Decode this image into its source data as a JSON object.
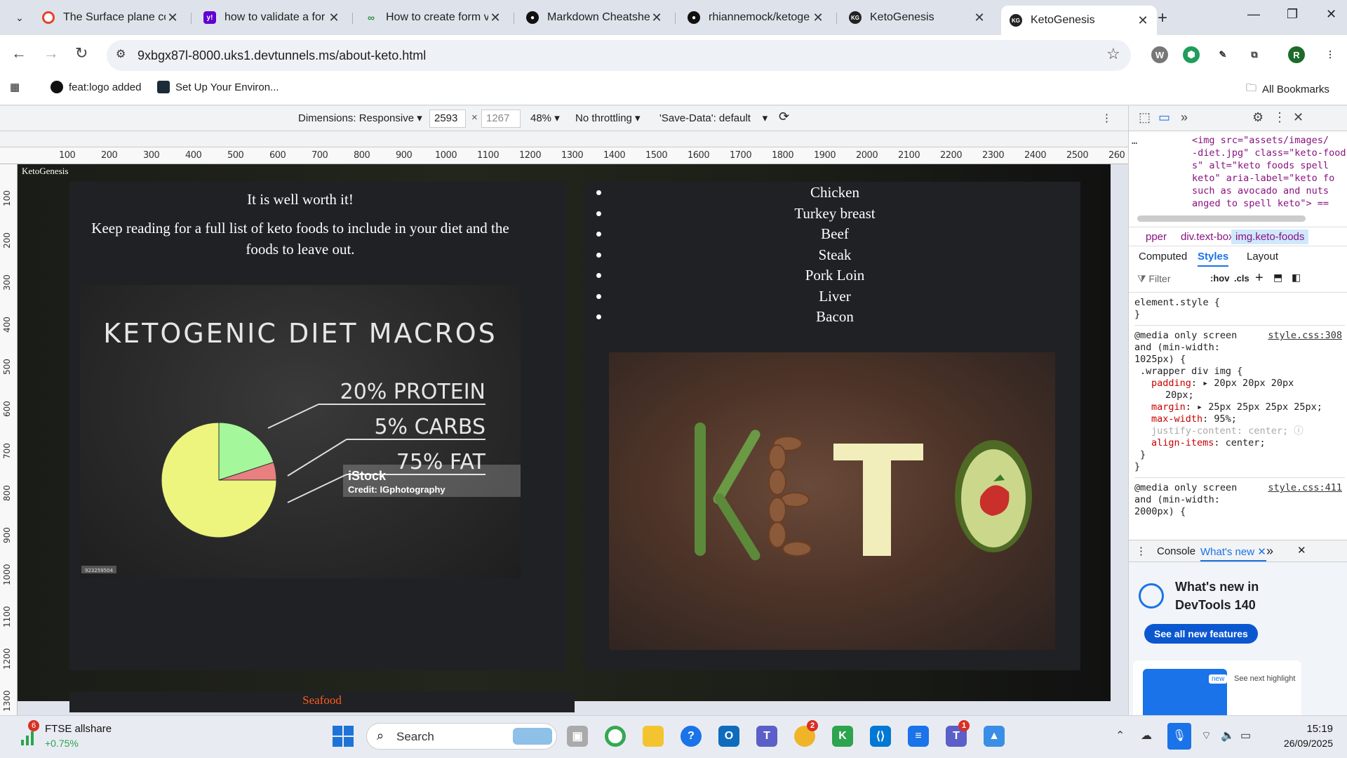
{
  "browser": {
    "tabs": [
      {
        "title": "The Surface plane co",
        "icon": "opera-icon",
        "color": "#e8412a"
      },
      {
        "title": "how to validate a for",
        "icon": "yahoo-icon",
        "color": "#6001d2"
      },
      {
        "title": "How to create form v",
        "icon": "geeks-icon",
        "color": "#2f8d46"
      },
      {
        "title": "Markdown Cheatshe",
        "icon": "github-icon",
        "color": "#111111"
      },
      {
        "title": "rhiannemock/ketoge",
        "icon": "github-icon",
        "color": "#111111"
      },
      {
        "title": "KetoGenesis",
        "icon": "kg-icon",
        "color": "#222222"
      },
      {
        "title": "KetoGenesis",
        "icon": "kg-icon",
        "color": "#222222"
      }
    ],
    "url": "9xbgx87l-8000.uks1.devtunnels.ms/about-keto.html",
    "bookmarks": [
      {
        "label": "feat:logo added",
        "icon": "github-icon"
      },
      {
        "label": "Set Up Your Environ...",
        "icon": "react-icon"
      }
    ],
    "all_bookmarks": "All Bookmarks",
    "profile_initial": "R"
  },
  "device_toolbar": {
    "dimensions": "Dimensions: Responsive",
    "width": "2593",
    "height": "1267",
    "zoom": "48%",
    "throttling": "No throttling",
    "save_data": "'Save-Data': default"
  },
  "ruler": {
    "h_labels": [
      "100",
      "200",
      "300",
      "400",
      "500",
      "600",
      "700",
      "800",
      "900",
      "1000",
      "1100",
      "1200",
      "1300",
      "1400",
      "1500",
      "1600",
      "1700",
      "1800",
      "1900",
      "2000",
      "2100",
      "2200",
      "2300",
      "2400",
      "2500",
      "260"
    ],
    "v_labels": [
      "100",
      "200",
      "300",
      "400",
      "500",
      "600",
      "700",
      "800",
      "900",
      "1000",
      "1100",
      "1200",
      "1300"
    ]
  },
  "page": {
    "site_title": "KetoGenesis",
    "worth": "It is well worth it!",
    "keep_reading": "Keep reading for a full list of keto foods to include in your diet and the foods to leave out.",
    "macros_image": {
      "title": "KETOGENIC DIET MACROS",
      "protein": "20% PROTEIN",
      "carbs": "5% CARBS",
      "fat": "75% FAT",
      "watermark": "iStock",
      "credit": "Credit: IGphotography",
      "stock_id": "923259504",
      "colors": {
        "protein": "#a4f79a",
        "carbs": "#e88080",
        "fat": "#eef57e"
      }
    },
    "meats": [
      "Chicken",
      "Turkey breast",
      "Beef",
      "Steak",
      "Pork Loin",
      "Liver",
      "Bacon"
    ],
    "seafood": "Seafood"
  },
  "devtools": {
    "html_snippet": [
      "<img src=\"assets/images/",
      "-diet.jpg\" class=\"keto-food",
      "s\" alt=\"keto foods spell",
      "keto\" aria-label=\"keto fo",
      "such as avocado and nuts",
      "anged to spell keto\"> =="
    ],
    "breadcrumbs": [
      "pper",
      "div.text-box",
      "img.keto-foods"
    ],
    "tabs": [
      "Computed",
      "Styles",
      "Layout"
    ],
    "filter_placeholder": "Filter",
    "hov": ":hov",
    "cls": ".cls",
    "element_style": "element.style {",
    "close_brace": "}",
    "rule1": {
      "media": "@media only screen",
      "media2": "and (min-width:",
      "media3": "1025px) {",
      "source": "style.css:308",
      "selector": ".wrapper div img {",
      "props": [
        {
          "name": "padding",
          "value": "20px 20px 20px",
          "cont": "20px;",
          "arrow": true
        },
        {
          "name": "margin",
          "value": "25px 25px 25px 25px;",
          "arrow": true
        },
        {
          "name": "max-width",
          "value": "95%;"
        },
        {
          "name": "justify-content",
          "value": "center;",
          "disabled": true
        },
        {
          "name": "align-items",
          "value": "center;"
        }
      ]
    },
    "rule2": {
      "media": "@media only screen",
      "media2": "and (min-width:",
      "media3": "2000px) {",
      "source": "style.css:411"
    },
    "drawer_tabs": [
      "Console",
      "What's new"
    ],
    "whats_new_title": "What's new in DevTools 140",
    "see_all": "See all new features",
    "new_badge": "new",
    "next_highlight": "See next highlight"
  },
  "taskbar": {
    "stock_name": "FTSE allshare",
    "stock_change": "+0.75%",
    "stock_badge": "6",
    "search": "Search",
    "time": "15:19",
    "date": "26/09/2025",
    "copilot_badge": "2",
    "teams_badge": "1"
  }
}
